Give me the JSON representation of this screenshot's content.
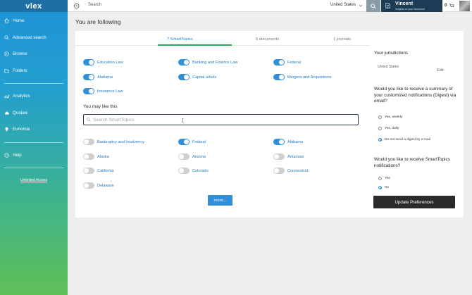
{
  "brand": {
    "logo_text": "vlex"
  },
  "sidebar": {
    "items": [
      {
        "label": "Home",
        "icon": "home-icon"
      },
      {
        "label": "Advanced search",
        "icon": "search-icon"
      },
      {
        "label": "Browse",
        "icon": "compass-icon"
      },
      {
        "label": "Folders",
        "icon": "folder-icon"
      },
      {
        "label": "Analytics",
        "icon": "bar-chart-icon"
      },
      {
        "label": "Quolaw",
        "icon": "cloud-icon"
      },
      {
        "label": "Eunomia",
        "icon": "lightbulb-icon"
      },
      {
        "label": "Help",
        "icon": "help-icon"
      }
    ],
    "unlimited_access": "Unlimited Access"
  },
  "topbar": {
    "search_label": "Search",
    "country": "United States",
    "user_name": "Vincent",
    "user_subtitle": "Insights on your document",
    "count": "0"
  },
  "page": {
    "title": "You are following"
  },
  "tabs": [
    {
      "label": "7 SmartTopics",
      "active": true
    },
    {
      "label": "5 documents",
      "active": false
    },
    {
      "label": "1 journals",
      "active": false
    }
  ],
  "following": [
    {
      "label": "Education Law",
      "on": true
    },
    {
      "label": "Banking and Finance Law",
      "on": true
    },
    {
      "label": "Federal",
      "on": true
    },
    {
      "label": "Alabama",
      "on": true
    },
    {
      "label": "Capital arkets",
      "on": true
    },
    {
      "label": "Mergers and Acquisitions",
      "on": true
    },
    {
      "label": "Insurance Law",
      "on": true
    }
  ],
  "suggestions": {
    "title": "You may like this",
    "search_placeholder": "Search SmartTopics",
    "items": [
      {
        "label": "Bankruptcy and Insolvency",
        "on": false
      },
      {
        "label": "Federal",
        "on": true
      },
      {
        "label": "Alabama",
        "on": true
      },
      {
        "label": "Alaska",
        "on": false
      },
      {
        "label": "Arizona",
        "on": false
      },
      {
        "label": "Arkansas",
        "on": false
      },
      {
        "label": "California",
        "on": false
      },
      {
        "label": "Colorado",
        "on": false
      },
      {
        "label": "Connecticut",
        "on": false
      },
      {
        "label": "Delaware",
        "on": false
      }
    ],
    "more_label": "more..."
  },
  "preferences": {
    "jurisdictions_title": "Your jurisdictions",
    "jurisdiction": "United States",
    "edit_label": "Edit",
    "digest_question": "Would you like to receive a summary of your customized notifications (Digest) via email?",
    "digest_options": [
      {
        "label": "Yes, weekly",
        "checked": false
      },
      {
        "label": "Yes, daily",
        "checked": false
      },
      {
        "label": "Do not send a digest by e-mail",
        "checked": true
      }
    ],
    "notif_question": "Would you like to receive SmartTopics notifications?",
    "notif_options": [
      {
        "label": "Yes",
        "checked": false
      },
      {
        "label": "No",
        "checked": true
      }
    ],
    "update_label": "Update Preferences"
  },
  "colors": {
    "accent": "#2f8fd8",
    "tab_underline": "#2aa55a",
    "user_bar": "#1e3b55",
    "update_button": "#2b2b2b"
  }
}
